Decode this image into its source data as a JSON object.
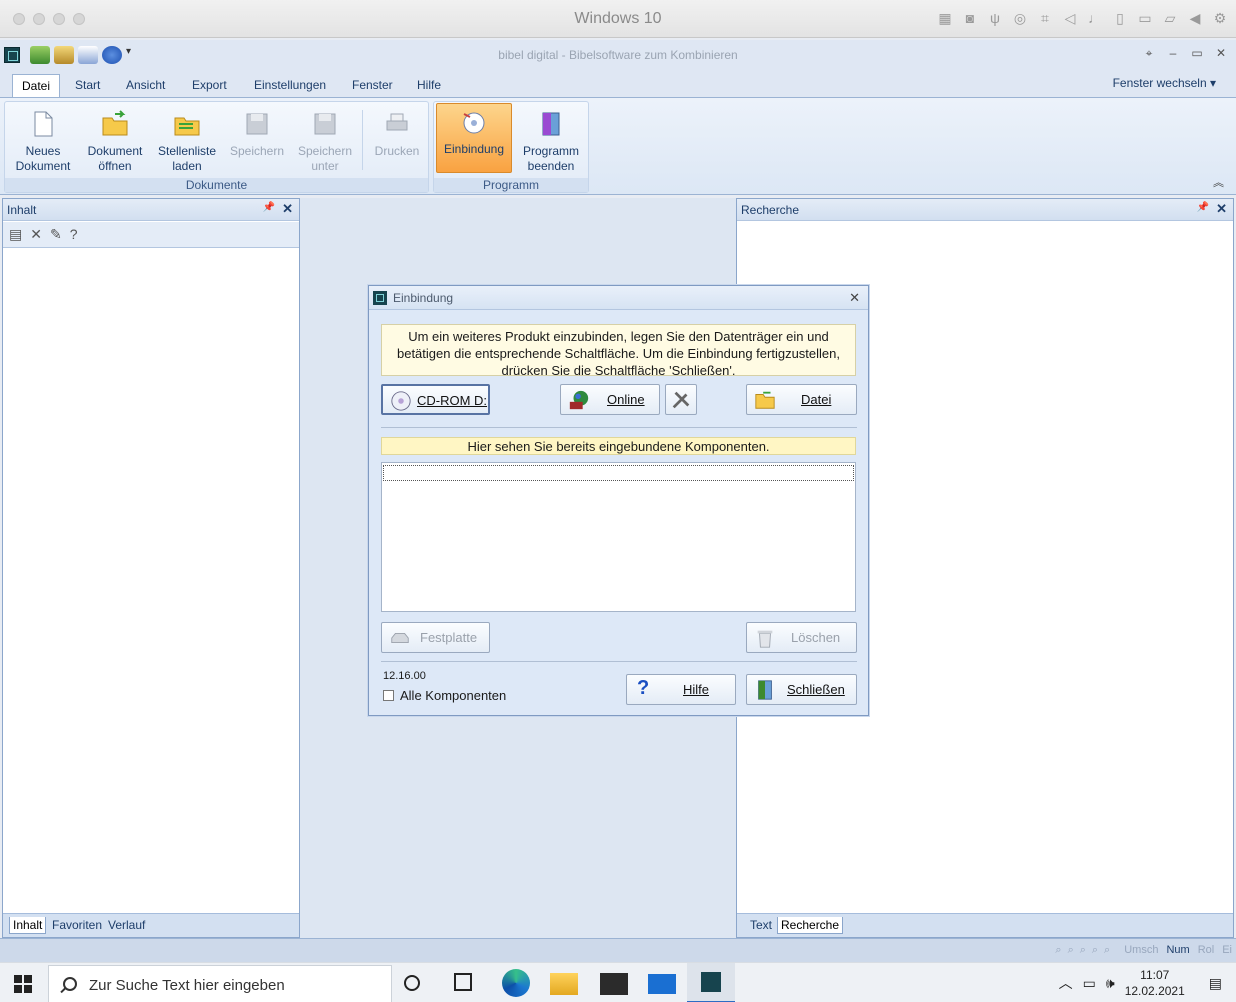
{
  "host": {
    "title": "Windows 10"
  },
  "app": {
    "title": "bibel digital - Bibelsoftware zum Kombinieren",
    "tabs": [
      "Datei",
      "Start",
      "Ansicht",
      "Export",
      "Einstellungen",
      "Fenster",
      "Hilfe"
    ],
    "active_tab": "Datei",
    "switch_window": "Fenster wechseln"
  },
  "ribbon": {
    "groups": {
      "documents": "Dokumente",
      "program": "Programm"
    },
    "buttons": {
      "new_doc": [
        "Neues",
        "Dokument"
      ],
      "open_doc": [
        "Dokument",
        "öffnen"
      ],
      "load_list": [
        "Stellenliste",
        "laden"
      ],
      "save": [
        "Speichern",
        ""
      ],
      "save_as": [
        "Speichern",
        "unter"
      ],
      "print": [
        "Drucken",
        ""
      ],
      "integrate": [
        "Einbindung",
        ""
      ],
      "quit": [
        "Programm",
        "beenden"
      ]
    }
  },
  "left_pane": {
    "title": "Inhalt",
    "tabs": [
      "Inhalt",
      "Favoriten",
      "Verlauf"
    ],
    "active_tab": "Inhalt"
  },
  "right_pane": {
    "title": "Recherche",
    "tabs": [
      "Text",
      "Recherche"
    ],
    "active_tab": "Recherche"
  },
  "status": {
    "items": [
      "Umsch",
      "Num",
      "Rol",
      "Ei"
    ]
  },
  "dialog": {
    "title": "Einbindung",
    "info_lines": [
      "Um ein weiteres Produkt einzubinden, legen Sie den Datenträger ein und",
      "betätigen die entsprechende Schaltfläche. Um die Einbindung fertigzustellen,",
      "drücken Sie die Schaltfläche 'Schließen'."
    ],
    "cdrom": "CD-ROM D:",
    "online": "Online",
    "file": "Datei",
    "components_label": "Hier sehen Sie bereits eingebundene Komponenten.",
    "harddisk": "Festplatte",
    "delete": "Löschen",
    "version": "12.16.00",
    "all_components": "Alle Komponenten",
    "help": "Hilfe",
    "close": "Schließen"
  },
  "taskbar": {
    "search_placeholder": "Zur Suche Text hier eingeben",
    "time": "11:07",
    "date": "12.02.2021"
  }
}
